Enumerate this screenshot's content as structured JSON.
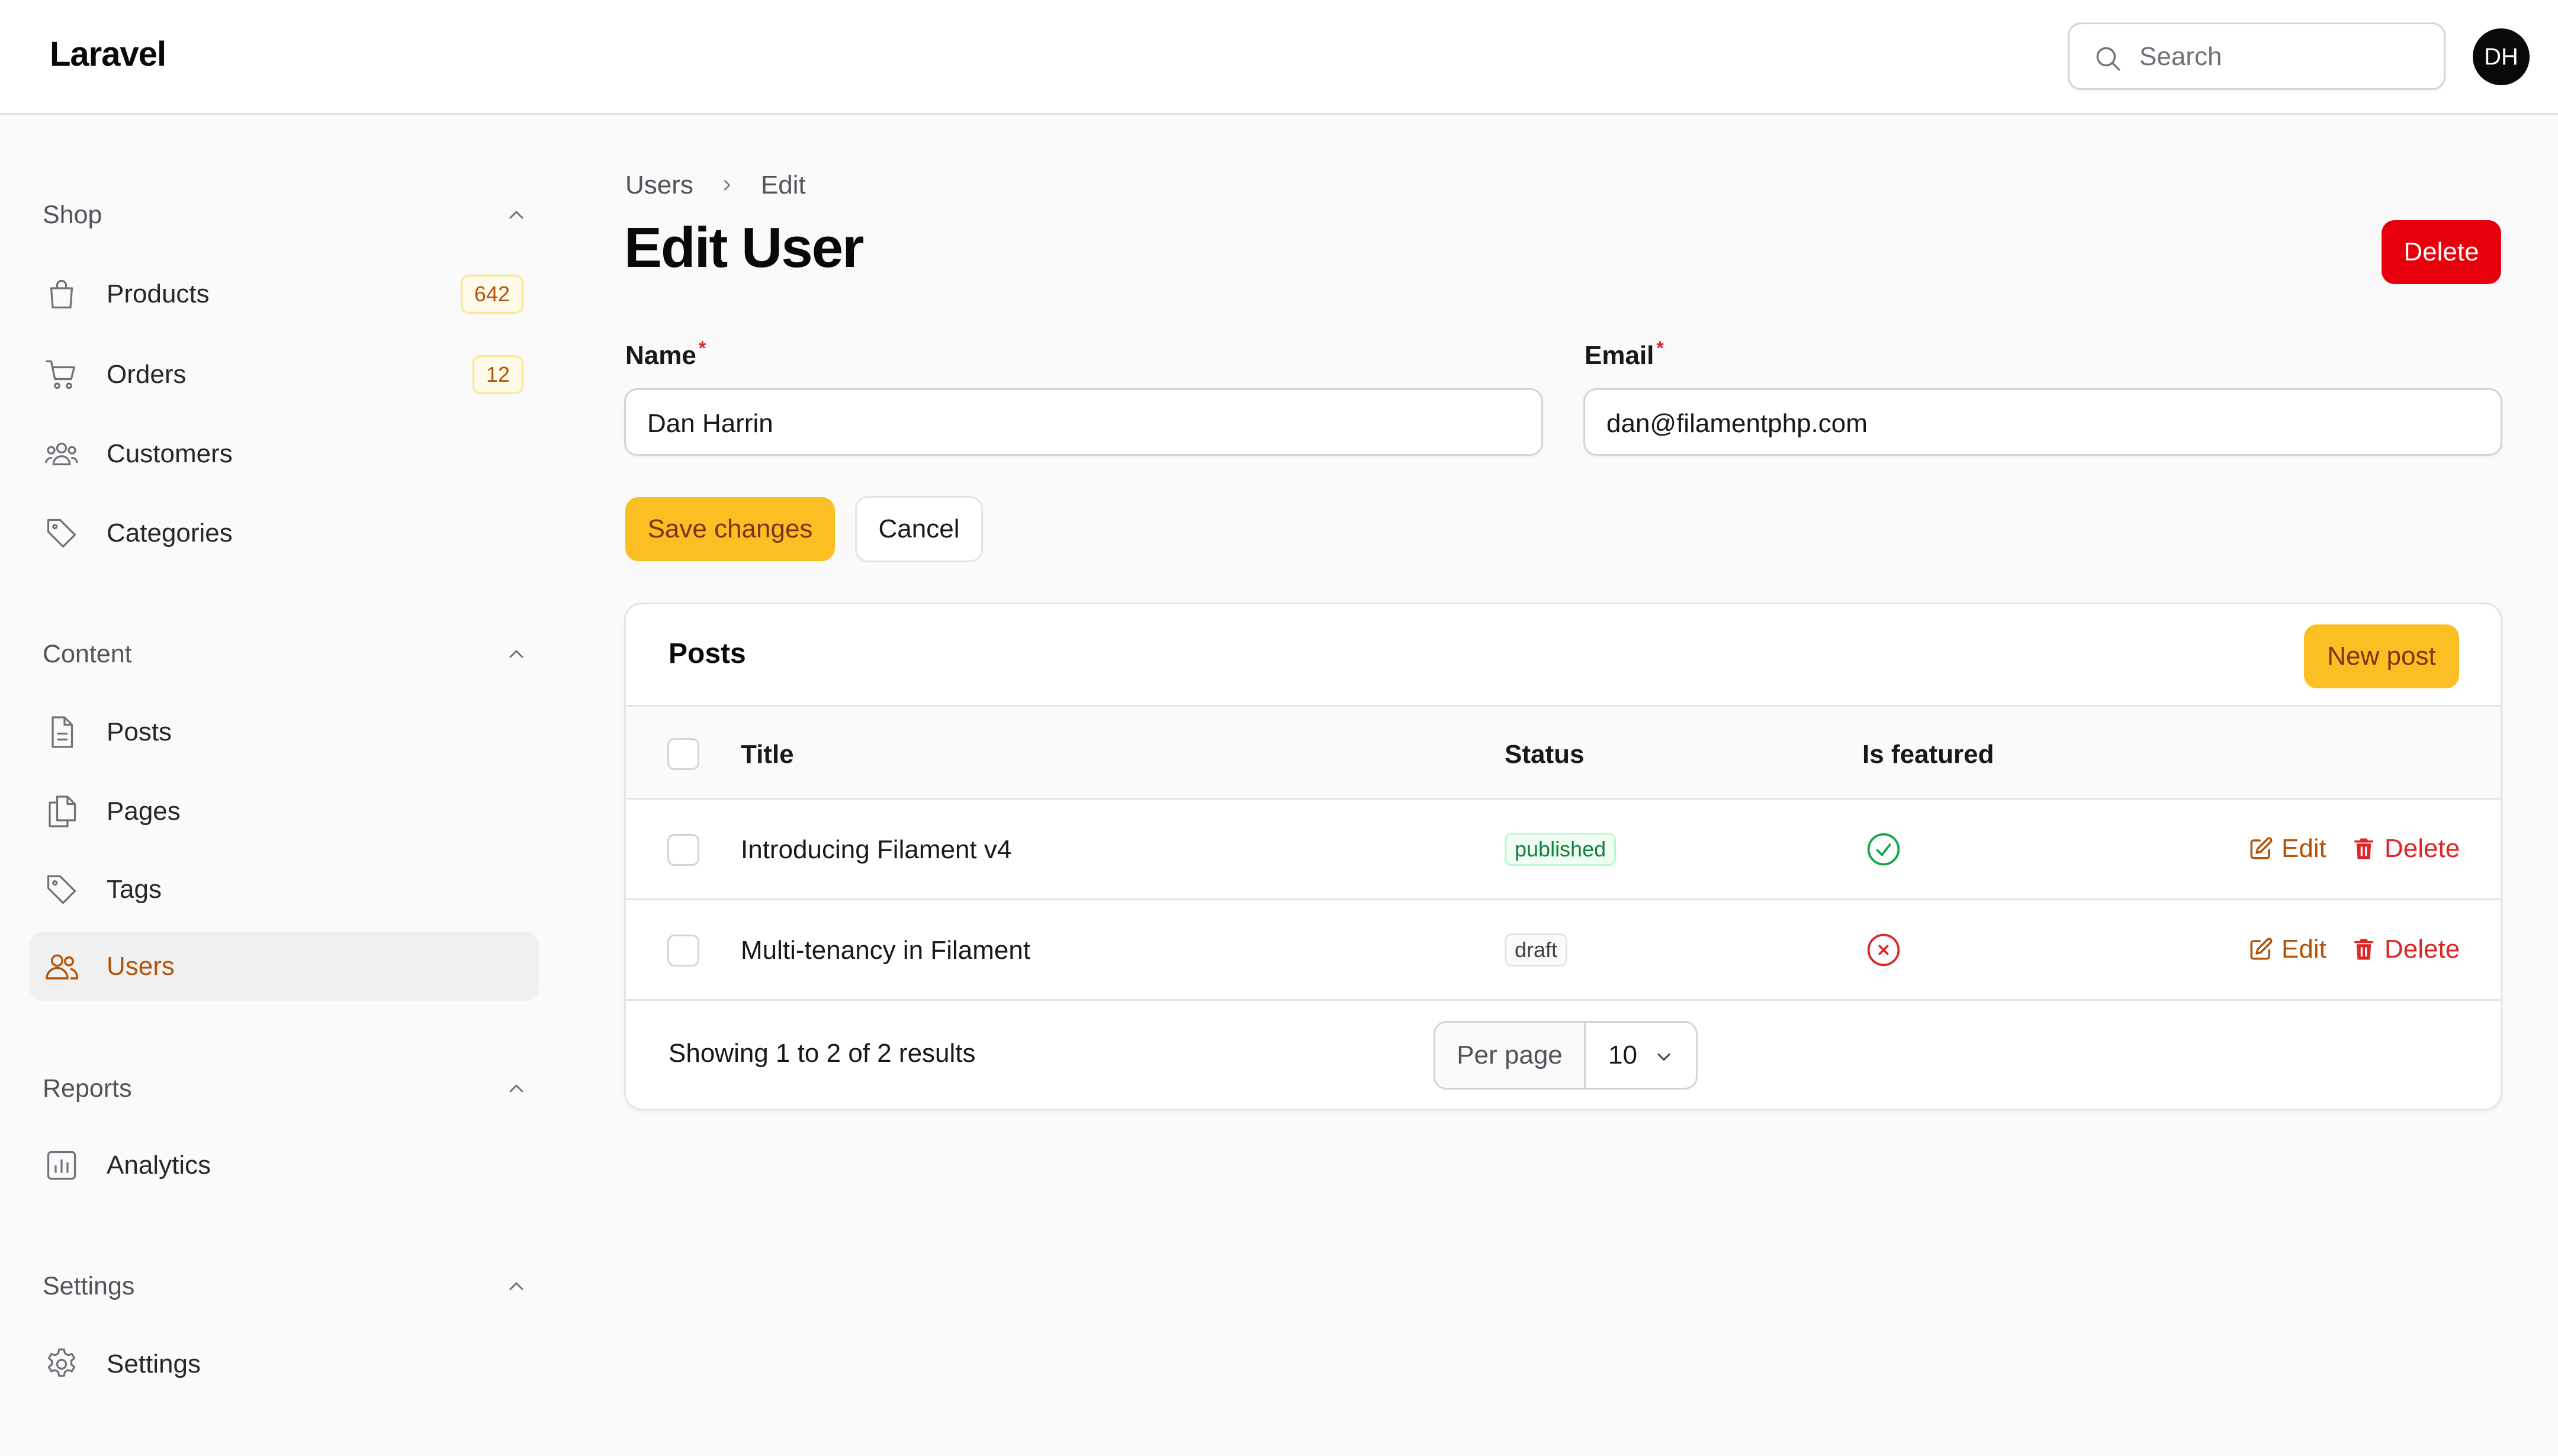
{
  "app": {
    "brand": "Laravel"
  },
  "header": {
    "search_placeholder": "Search",
    "avatar_initials": "DH"
  },
  "sidebar": {
    "groups": [
      {
        "label": "Shop",
        "items": [
          {
            "label": "Products",
            "icon": "shopping-bag-icon",
            "badge": "642"
          },
          {
            "label": "Orders",
            "icon": "shopping-cart-icon",
            "badge": "12"
          },
          {
            "label": "Customers",
            "icon": "user-group-icon"
          },
          {
            "label": "Categories",
            "icon": "tag-icon"
          }
        ]
      },
      {
        "label": "Content",
        "items": [
          {
            "label": "Posts",
            "icon": "document-icon"
          },
          {
            "label": "Pages",
            "icon": "documents-icon"
          },
          {
            "label": "Tags",
            "icon": "tag-icon"
          },
          {
            "label": "Users",
            "icon": "users-icon",
            "active": true
          }
        ]
      },
      {
        "label": "Reports",
        "items": [
          {
            "label": "Analytics",
            "icon": "chart-bar-icon"
          }
        ]
      },
      {
        "label": "Settings",
        "items": [
          {
            "label": "Settings",
            "icon": "cog-icon"
          }
        ]
      }
    ]
  },
  "breadcrumb": {
    "parent": "Users",
    "current": "Edit"
  },
  "page": {
    "title": "Edit User",
    "delete_label": "Delete"
  },
  "form": {
    "name_label": "Name",
    "name_value": "Dan Harrin",
    "email_label": "Email",
    "email_value": "dan@filamentphp.com",
    "required_marker": "*",
    "save_label": "Save changes",
    "cancel_label": "Cancel"
  },
  "posts": {
    "title": "Posts",
    "new_label": "New post",
    "columns": {
      "title": "Title",
      "status": "Status",
      "featured": "Is featured"
    },
    "rows": [
      {
        "title": "Introducing Filament v4",
        "status": "published",
        "featured": true,
        "featured_icon": "check-circle-icon"
      },
      {
        "title": "Multi-tenancy in Filament",
        "status": "draft",
        "featured": false,
        "featured_icon": "x-circle-icon"
      }
    ],
    "edit_label": "Edit",
    "delete_label": "Delete",
    "showing_text": "Showing 1 to 2 of 2 results",
    "per_page_label": "Per page",
    "per_page_value": "10"
  },
  "colors": {
    "primary": "#fbbf24",
    "danger": "#e7000b",
    "success": "#16a34a",
    "active_text": "#b45309"
  }
}
